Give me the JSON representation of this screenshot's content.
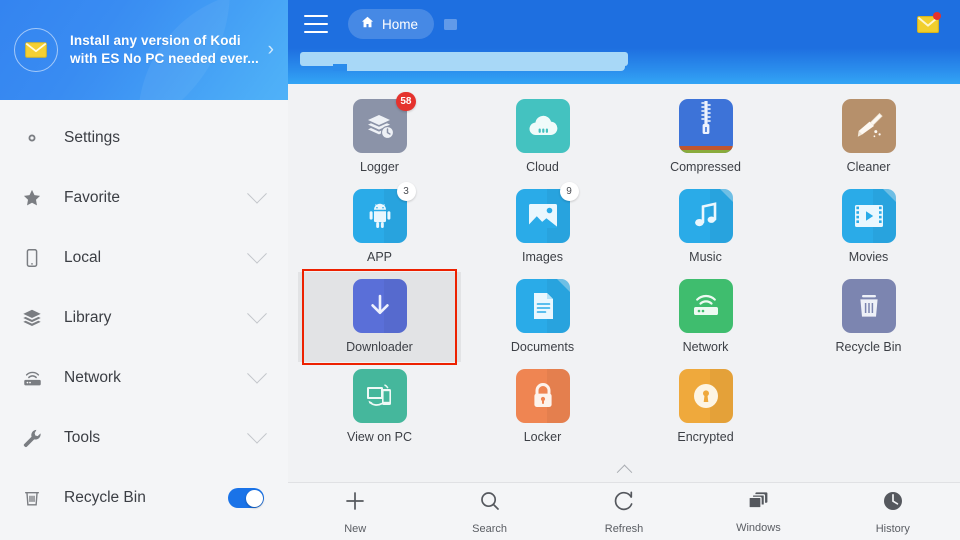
{
  "sidebar": {
    "promo": {
      "icon": "envelope-icon",
      "line1": "Install any version of Kodi",
      "line2": "with ES No PC needed ever...",
      "chevron": "chevron-right-icon"
    },
    "items": [
      {
        "label": "Settings",
        "icon": "gear-icon",
        "trailing": "none"
      },
      {
        "label": "Favorite",
        "icon": "star-icon",
        "trailing": "chevron"
      },
      {
        "label": "Local",
        "icon": "phone-icon",
        "trailing": "chevron"
      },
      {
        "label": "Library",
        "icon": "layers-icon",
        "trailing": "chevron"
      },
      {
        "label": "Network",
        "icon": "router-icon",
        "trailing": "chevron"
      },
      {
        "label": "Tools",
        "icon": "wrench-icon",
        "trailing": "chevron"
      },
      {
        "label": "Recycle Bin",
        "icon": "trash-icon",
        "trailing": "toggle",
        "toggle_on": true
      }
    ]
  },
  "topbar": {
    "menu_icon": "hamburger-icon",
    "tab_label": "Home",
    "tab_icon": "home-icon",
    "new_tab_icon": "square-icon",
    "mail_icon": "envelope-icon",
    "mail_has_notification": true,
    "background_color": "#1e6fe0"
  },
  "grid": {
    "selected": "Downloader",
    "items": [
      {
        "label": "Logger",
        "icon": "layers-clock-icon",
        "color": "#8b93a8",
        "badge": "58",
        "badge_style": "red"
      },
      {
        "label": "Cloud",
        "icon": "cloud-icon",
        "color": "#44c2c0",
        "badge": null,
        "badge_style": null
      },
      {
        "label": "Compressed",
        "icon": "zipper-icon",
        "color": "#3d73d8",
        "badge": null,
        "badge_style": null
      },
      {
        "label": "Cleaner",
        "icon": "broom-icon",
        "color": "#b6906b",
        "badge": null,
        "badge_style": null
      },
      {
        "label": "APP",
        "icon": "android-icon",
        "color": "#2aabe8",
        "badge": "3",
        "badge_style": "white"
      },
      {
        "label": "Images",
        "icon": "photo-icon",
        "color": "#2aabe8",
        "badge": "9",
        "badge_style": "white"
      },
      {
        "label": "Music",
        "icon": "music-note-icon",
        "color": "#2aabe8",
        "badge": null,
        "badge_style": null
      },
      {
        "label": "Movies",
        "icon": "film-play-icon",
        "color": "#2aabe8",
        "badge": null,
        "badge_style": null
      },
      {
        "label": "Downloader",
        "icon": "download-arrow-icon",
        "color": "#5a6fd8",
        "badge": null,
        "badge_style": null
      },
      {
        "label": "Documents",
        "icon": "document-icon",
        "color": "#2aabe8",
        "badge": null,
        "badge_style": null
      },
      {
        "label": "Network",
        "icon": "router-icon",
        "color": "#3fbd6e",
        "badge": null,
        "badge_style": null
      },
      {
        "label": "Recycle Bin",
        "icon": "trash-icon",
        "color": "#7c85b0",
        "badge": null,
        "badge_style": null
      },
      {
        "label": "View on PC",
        "icon": "screen-phone-icon",
        "color": "#45b79c",
        "badge": null,
        "badge_style": null
      },
      {
        "label": "Locker",
        "icon": "padlock-icon",
        "color": "#ef8552",
        "badge": null,
        "badge_style": null
      },
      {
        "label": "Encrypted",
        "icon": "keyhole-icon",
        "color": "#efa93c",
        "badge": null,
        "badge_style": null
      }
    ]
  },
  "bottombar": {
    "expand_icon": "chevron-up-icon",
    "items": [
      {
        "label": "New",
        "icon": "plus-icon"
      },
      {
        "label": "Search",
        "icon": "search-icon"
      },
      {
        "label": "Refresh",
        "icon": "refresh-icon"
      },
      {
        "label": "Windows",
        "icon": "windows-stack-icon"
      },
      {
        "label": "History",
        "icon": "clock-icon"
      }
    ]
  }
}
